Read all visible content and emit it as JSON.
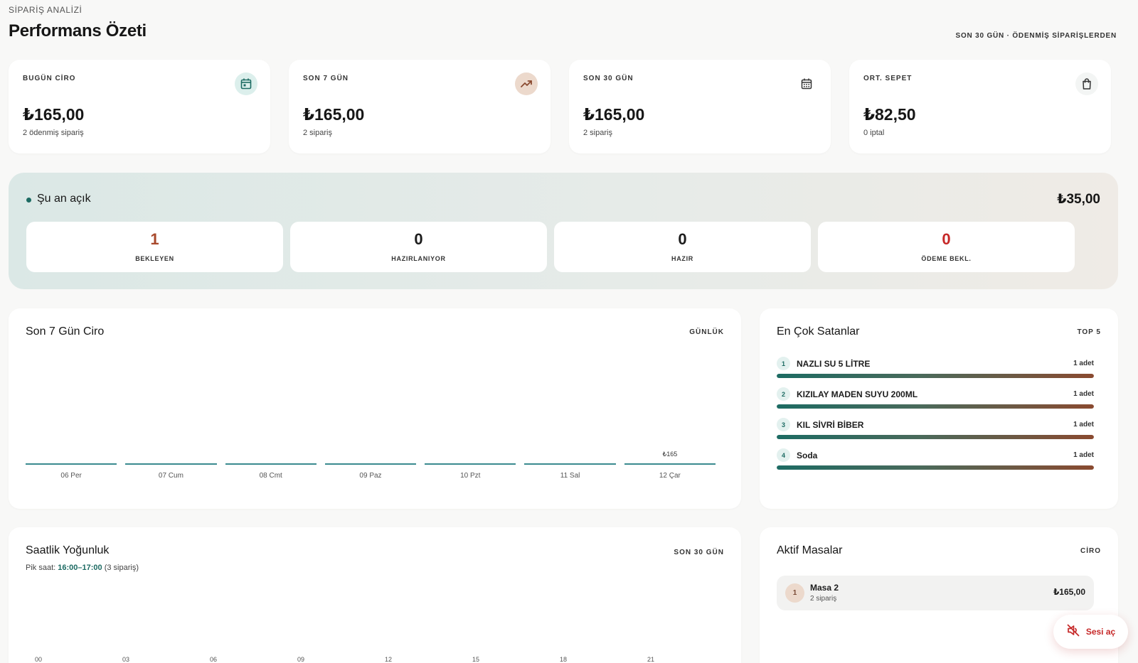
{
  "header": {
    "eyebrow": "SİPARİŞ ANALİZİ",
    "title": "Performans Özeti",
    "subtitle": "SON 30 GÜN · ÖDENMİŞ SİPARİŞLERDEN"
  },
  "kpis": [
    {
      "label": "BUGÜN CİRO",
      "value": "₺165,00",
      "sub": "2 ödenmiş sipariş",
      "icon": "calendar-day-icon",
      "icon_bg": "#dcefec",
      "icon_color": "#1d6b63"
    },
    {
      "label": "SON 7 GÜN",
      "value": "₺165,00",
      "sub": "2 sipariş",
      "icon": "trending-up-icon",
      "icon_bg": "#ecd9cc",
      "icon_color": "#8a4a30"
    },
    {
      "label": "SON 30 GÜN",
      "value": "₺165,00",
      "sub": "2 sipariş",
      "icon": "calendar-grid-icon",
      "icon_bg": "#ffffff",
      "icon_color": "#333333"
    },
    {
      "label": "ORT. SEPET",
      "value": "₺82,50",
      "sub": "0 iptal",
      "icon": "shopping-bag-icon",
      "icon_bg": "#f3f5f4",
      "icon_color": "#333333"
    }
  ],
  "open_orders": {
    "title": "Şu an açık",
    "amount": "₺35,00",
    "stats": [
      {
        "value": "1",
        "label": "BEKLEYEN",
        "color": "#a8492c"
      },
      {
        "value": "0",
        "label": "HAZIRLANIYOR",
        "color": "#161616"
      },
      {
        "value": "0",
        "label": "HAZIR",
        "color": "#161616"
      },
      {
        "value": "0",
        "label": "ÖDEME BEKL.",
        "color": "#c62828"
      }
    ]
  },
  "weekly": {
    "title": "Son 7 Gün Ciro",
    "tag": "GÜNLÜK",
    "value_label": "₺165"
  },
  "chart_data": {
    "type": "bar",
    "title": "Son 7 Gün Ciro",
    "categories": [
      "06 Per",
      "07 Cum",
      "08 Cmt",
      "09 Paz",
      "10 Pzt",
      "11 Sal",
      "12 Çar"
    ],
    "values": [
      0,
      0,
      0,
      0,
      0,
      0,
      165
    ],
    "xlabel": "",
    "ylabel": ""
  },
  "top_sellers": {
    "title": "En Çok Satanlar",
    "tag": "TOP 5",
    "items": [
      {
        "rank": "1",
        "name": "NAZLI SU 5 LİTRE",
        "qty": "1 adet",
        "share": 1.0
      },
      {
        "rank": "2",
        "name": "KIZILAY MADEN SUYU 200ML",
        "qty": "1 adet",
        "share": 1.0
      },
      {
        "rank": "3",
        "name": "KIL SİVRİ BİBER",
        "qty": "1 adet",
        "share": 1.0
      },
      {
        "rank": "4",
        "name": "Soda",
        "qty": "1 adet",
        "share": 1.0
      }
    ]
  },
  "hourly": {
    "title": "Saatlik Yoğunluk",
    "tag": "SON 30 GÜN",
    "peak_prefix": "Pik saat: ",
    "peak_hours": "16:00–17:00",
    "peak_suffix": " (3 sipariş)",
    "hour_labels": [
      "00",
      "03",
      "06",
      "09",
      "12",
      "15",
      "18",
      "21"
    ]
  },
  "active_tables": {
    "title": "Aktif Masalar",
    "tag": "CİRO",
    "rows": [
      {
        "rank": "1",
        "name": "Masa 2",
        "sub": "2 sipariş",
        "amount": "₺165,00"
      }
    ]
  },
  "sound_button": {
    "label": "Sesi aç",
    "icon": "speaker-muted-icon"
  }
}
